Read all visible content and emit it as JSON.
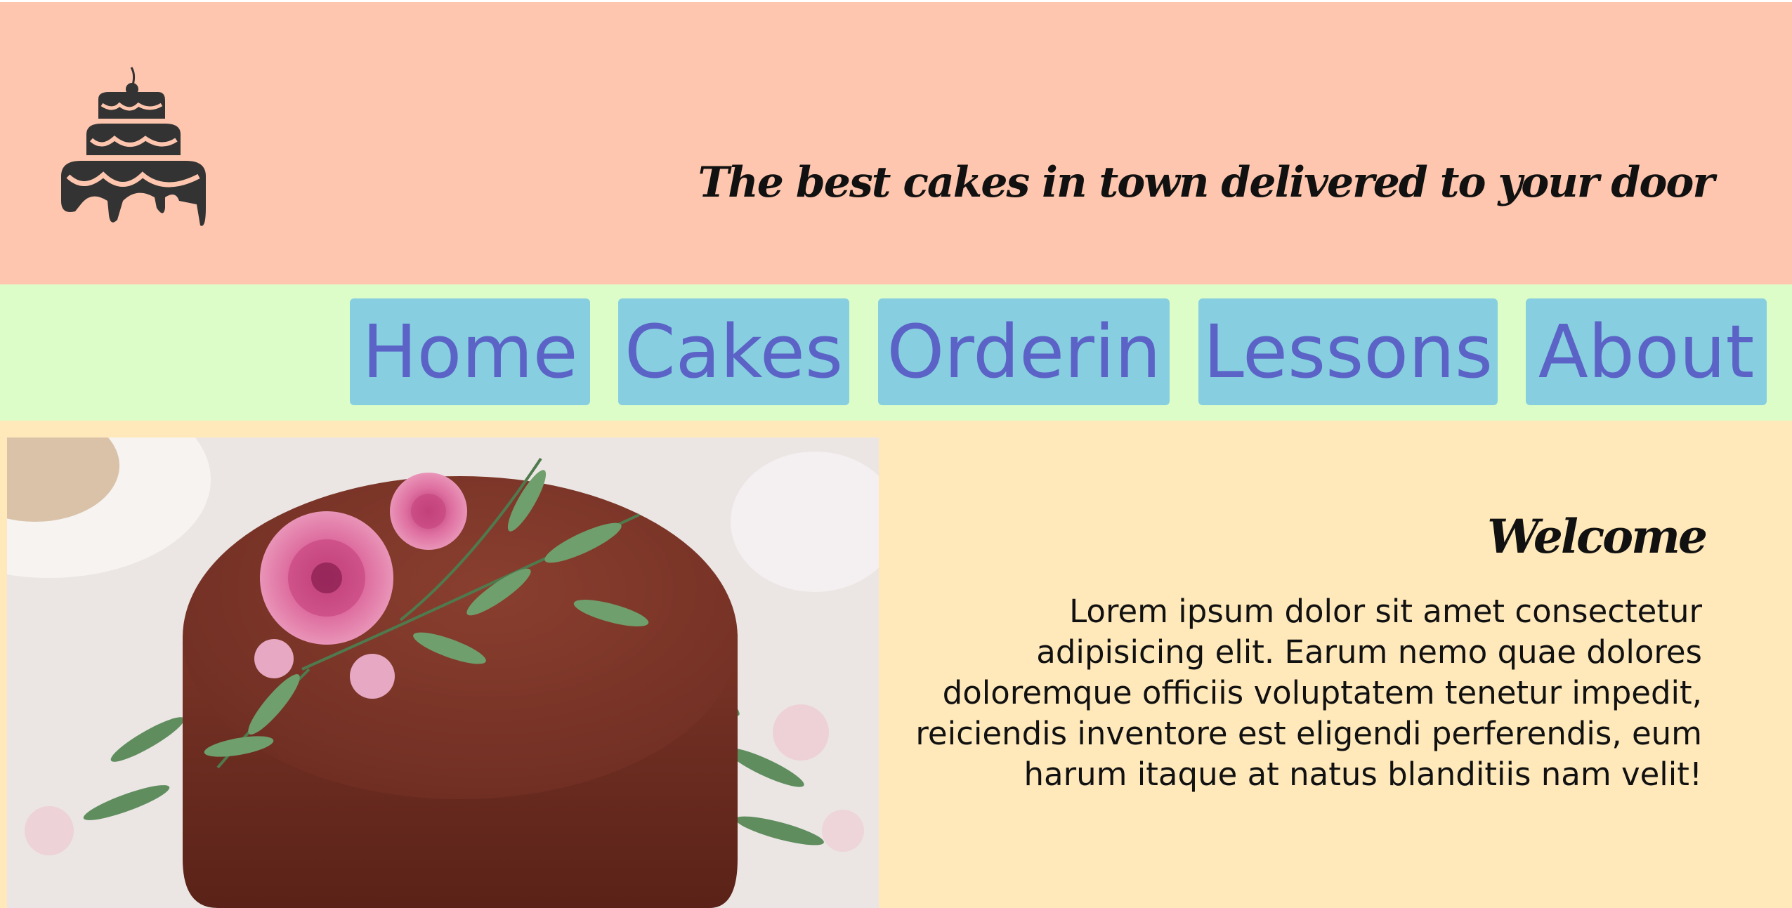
{
  "header": {
    "logo_icon": "tiered-cake-icon",
    "tagline": "The best cakes in town delivered to your door"
  },
  "nav": {
    "items": [
      {
        "label": "Home"
      },
      {
        "label": "Cakes"
      },
      {
        "label": "Orderin"
      },
      {
        "label": "Lessons"
      },
      {
        "label": "About"
      }
    ]
  },
  "main": {
    "image": "chocolate-cake-with-roses-photo",
    "heading": "Welcome",
    "paragraph": "Lorem ipsum dolor sit amet consectetur adipisicing elit. Earum nemo quae dolores doloremque officiis voluptatem tenetur impedit, reiciendis inventore est eligendi perferendis, eum harum itaque at natus blanditiis nam velit!"
  },
  "colors": {
    "header_bg": "#fec6ae",
    "nav_bg": "#dcfdc8",
    "nav_button_bg": "#87cee0",
    "nav_text": "#5b63c6",
    "main_bg": "#ffe9bb"
  }
}
